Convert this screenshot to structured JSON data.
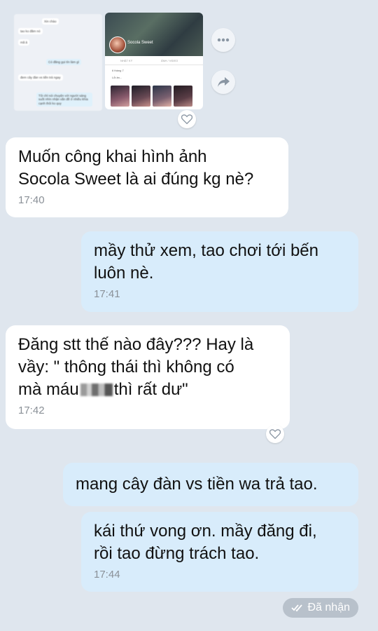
{
  "preview": {
    "chat_thumb": {
      "lines": [
        "Xin chào",
        "tao ko đăm nó",
        "mã ả",
        "Có đăng gọi tín làm gì",
        "đem cây đàn vs tiền trả ngay",
        "Tôi chỉ nói chuyện với người sáng suốt nhìn nhận vấn đề ở nhiều khía cạnh thôi ko quy"
      ]
    },
    "profile_thumb": {
      "name": "Socola Sweet",
      "tabs": [
        "NHẬT KÝ",
        "ẢNH / VIDEO"
      ],
      "comment_lines": [
        "6 tháng 7",
        "Lỗi ân..."
      ]
    }
  },
  "messages": [
    {
      "side": "in",
      "text": "Muốn công khai hình ảnh\nSocola Sweet là ai đúng kg nè?",
      "time": "17:40"
    },
    {
      "side": "out",
      "text": "mầy thử xem, tao chơi tới bến\nluôn nè.",
      "time": "17:41"
    },
    {
      "side": "in",
      "text_before": "Đăng stt thế nào đây??? Hay là\nvầy: \" thông thái thì không có\nmà máu",
      "text_after": "thì rất dư\"",
      "time": "17:42"
    },
    {
      "side": "out",
      "text": "mang cây đàn vs tiền wa trả tao."
    },
    {
      "side": "out",
      "text": "kái thứ vong ơn. mầy đăng đi,\nrồi tao đừng trách tao.",
      "time": "17:44"
    }
  ],
  "status": {
    "label": "Đã nhận",
    "icon": "double-check-icon"
  }
}
